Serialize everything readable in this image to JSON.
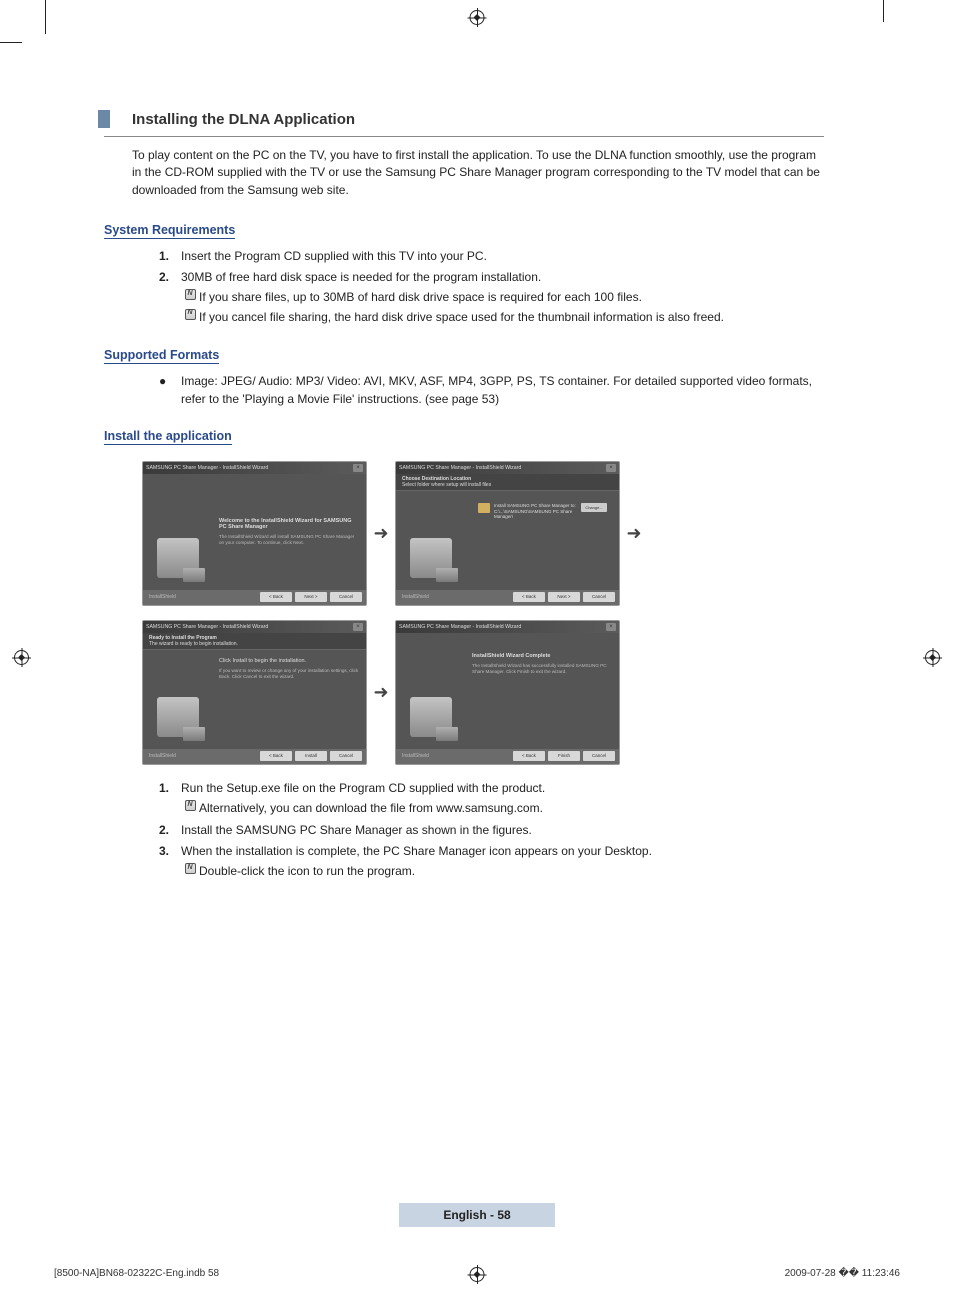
{
  "heading": "Installing the DLNA Application",
  "intro": "To play content on the PC on the TV, you have to first install the application. To use the DLNA function smoothly, use the program in the CD-ROM supplied with the TV or use the Samsung PC Share Manager program corresponding to the TV model that can be downloaded from the Samsung web site.",
  "sections": {
    "sysreq": {
      "title": "System Requirements",
      "items": [
        {
          "num": "1.",
          "text": "Insert the Program CD supplied with this TV into your PC."
        },
        {
          "num": "2.",
          "text": "30MB of free hard disk space is needed for the program  installation.",
          "notes": [
            "If you share files, up to 30MB of hard disk drive space is required for each 100 files.",
            "If you cancel file sharing, the hard disk drive space used for the thumbnail information is also freed."
          ]
        }
      ]
    },
    "formats": {
      "title": "Supported Formats",
      "bullet": "Image: JPEG/ Audio: MP3/ Video: AVI, MKV, ASF, MP4, 3GPP, PS, TS container. For detailed supported video formats, refer to the 'Playing a Movie File' instructions. (see page 53)"
    },
    "install": {
      "title": "Install the application",
      "items": [
        {
          "num": "1.",
          "text": "Run the Setup.exe file on the Program CD supplied with the product.",
          "notes": [
            "Alternatively, you can download the file from www.samsung.com."
          ]
        },
        {
          "num": "2.",
          "text": "Install the SAMSUNG PC Share Manager as shown in the figures."
        },
        {
          "num": "3.",
          "text": "When the installation is complete, the PC Share Manager icon appears on your Desktop.",
          "notes": [
            "Double-click the icon to run the program."
          ]
        }
      ]
    }
  },
  "dialogs": {
    "common_title": "SAMSUNG PC Share Manager - InstallShield Wizard",
    "step1": {
      "main": "Welcome to the InstallShield Wizard for SAMSUNG PC Share Manager",
      "sub": "The InstallShield Wizard will install SAMSUNG PC Share Manager on your computer. To continue, click Next.",
      "brand": "InstallShield",
      "buttons": [
        "< Back",
        "Next >",
        "Cancel"
      ]
    },
    "step2": {
      "sub_title": "Choose Destination Location",
      "sub_desc": "Select folder where setup will install files",
      "dest_label": "Install SAMSUNG PC Share Manager to:",
      "dest_path": "C:\\...\\SAMSUNG\\SAMSUNG PC Share Manager\\",
      "change": "Change...",
      "brand": "InstallShield",
      "buttons": [
        "< Back",
        "Next >",
        "Cancel"
      ]
    },
    "step3": {
      "sub_title": "Ready to Install the Program",
      "sub_desc": "The wizard is ready to begin installation.",
      "main": "Click Install to begin the installation.",
      "sub": "If you want to review or change any of your installation settings, click Back. Click Cancel to exit the wizard.",
      "brand": "InstallShield",
      "buttons": [
        "< Back",
        "Install",
        "Cancel"
      ]
    },
    "step4": {
      "main": "InstallShield Wizard Complete",
      "sub": "The InstallShield Wizard has successfully installed SAMSUNG PC Share Manager. Click Finish to exit the wizard.",
      "brand": "InstallShield",
      "buttons": [
        "< Back",
        "Finish",
        "Cancel"
      ]
    }
  },
  "page_number": "English - 58",
  "footer_left": "[8500-NA]BN68-02322C-Eng.indb   58",
  "footer_right": "2009-07-28   �� 11:23:46"
}
